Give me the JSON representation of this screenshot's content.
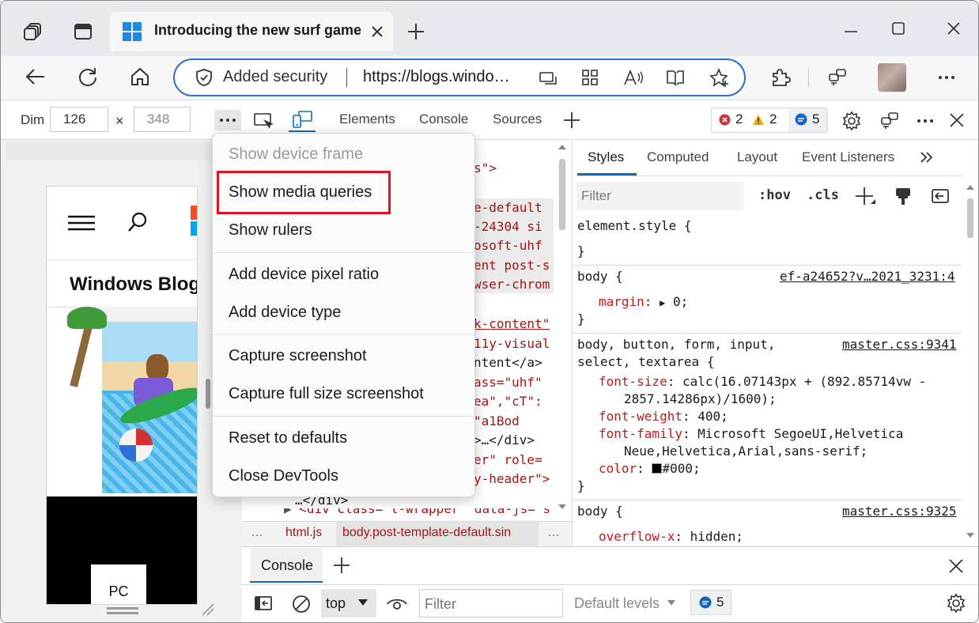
{
  "browser": {
    "tab_title": "Introducing the new surf game i",
    "address": {
      "security_label": "Added security",
      "url": "https://blogs.windo…"
    }
  },
  "device_toolbar": {
    "dimension_label": "Dim",
    "width": "126",
    "height": "348",
    "times": "×"
  },
  "device_page": {
    "blog_title": "Windows Blog",
    "pc_label": "PC"
  },
  "devtools": {
    "tabs": [
      "Elements",
      "Console",
      "Sources"
    ],
    "errors": "2",
    "warnings": "2",
    "messages": "5",
    "elements_lines": [
      {
        "t": "s\">"
      },
      {
        "t": "e-default"
      },
      {
        "t": "-24304 si"
      },
      {
        "t": "osoft-uhf"
      },
      {
        "t": "ent post-s"
      },
      {
        "t": "wser-chrom"
      },
      {
        "t": "k-content\""
      },
      {
        "t": "11y-visual"
      },
      {
        "t": "ntent</a>"
      },
      {
        "t": "ass=\"uhf\""
      },
      {
        "t": "ea\",\"cT\":"
      },
      {
        "t": "\"a1Bod"
      },
      {
        "t": ">…</div>"
      },
      {
        "t": "er\" role="
      },
      {
        "t": "y-header\">"
      },
      {
        "t": "…</div>"
      },
      {
        "t": "<div class=\"l-wrapper\" data-js=\"s"
      }
    ],
    "breadcrumbs": {
      "more": "…",
      "html": "html.js",
      "body": "body.post-template-default.sin",
      "more2": "…"
    },
    "styles_tabs": [
      "Styles",
      "Computed",
      "Layout",
      "Event Listeners"
    ],
    "filter_placeholder": "Filter",
    "hov": ":hov",
    "cls": ".cls",
    "rules": {
      "element_style": "element.style {",
      "close": "}",
      "body1_selector": "body {",
      "body1_source": "ef-a24652?v…2021_3231:4",
      "margin_prop": "margin",
      "margin_val": "0;",
      "rule3_selector_1": "body, button, form, input,",
      "rule3_selector_2": "select, textarea {",
      "rule3_source": "master.css:9341",
      "font_size_prop": "font-size",
      "font_size_val_1": "calc(16.07143px + (892.85714vw -",
      "font_size_val_2": "2857.14286px)/1600);",
      "font_weight_prop": "font-weight",
      "font_weight_val": "400;",
      "font_family_prop": "font-family",
      "font_family_val_1": "Microsoft SegoeUI,Helvetica",
      "font_family_val_2": "Neue,Helvetica,Arial,sans-serif;",
      "color_prop": "color",
      "color_val": "#000;",
      "body2_selector": "body {",
      "body2_source": "master.css:9325",
      "overflow_prop": "overflow-x",
      "overflow_val": "hidden;"
    }
  },
  "drawer": {
    "tab": "Console",
    "context": "top",
    "filter_placeholder": "Filter",
    "levels": "Default levels",
    "messages": "5"
  },
  "context_menu": {
    "items": [
      "Show device frame",
      "Show media queries",
      "Show rulers",
      "Add device pixel ratio",
      "Add device type",
      "Capture screenshot",
      "Capture full size screenshot",
      "Reset to defaults",
      "Close DevTools"
    ],
    "highlighted_item": "Show media queries"
  },
  "colors": {
    "accent": "#0f6cbd",
    "highlight_box": "#e0131f",
    "error": "#d13438",
    "warning": "#f2a900"
  }
}
